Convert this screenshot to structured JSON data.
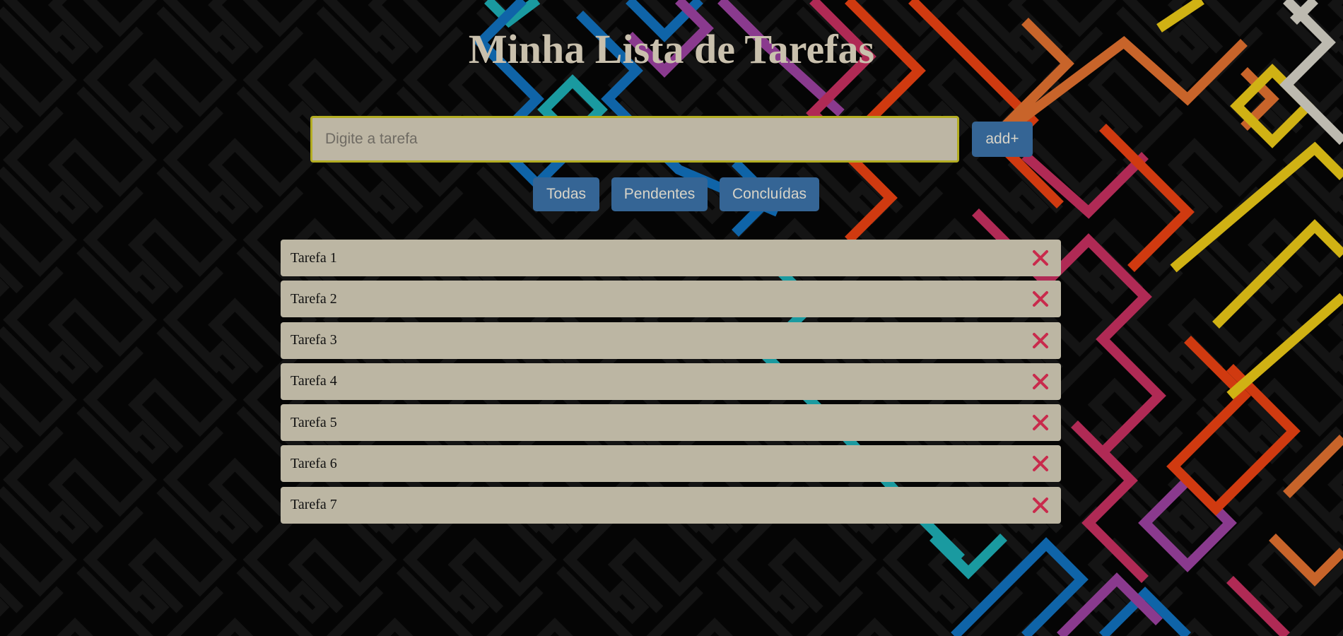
{
  "header": {
    "title": "Minha Lista de Tarefas"
  },
  "form": {
    "input_placeholder": "Digite a tarefa",
    "input_value": "",
    "add_label": "add+"
  },
  "filters": [
    {
      "label": "Todas"
    },
    {
      "label": "Pendentes"
    },
    {
      "label": "Concluídas"
    }
  ],
  "tasks": [
    {
      "label": "Tarefa 1"
    },
    {
      "label": "Tarefa 2"
    },
    {
      "label": "Tarefa 3"
    },
    {
      "label": "Tarefa 4"
    },
    {
      "label": "Tarefa 5"
    },
    {
      "label": "Tarefa 6"
    },
    {
      "label": "Tarefa 7"
    }
  ],
  "icons": {
    "delete": "close-icon"
  },
  "colors": {
    "title": "#c9c0ad",
    "button": "#356595",
    "input_border": "#b3ad22",
    "item_bg": "#bcb6a3",
    "delete_icon": "#c92a4c"
  }
}
